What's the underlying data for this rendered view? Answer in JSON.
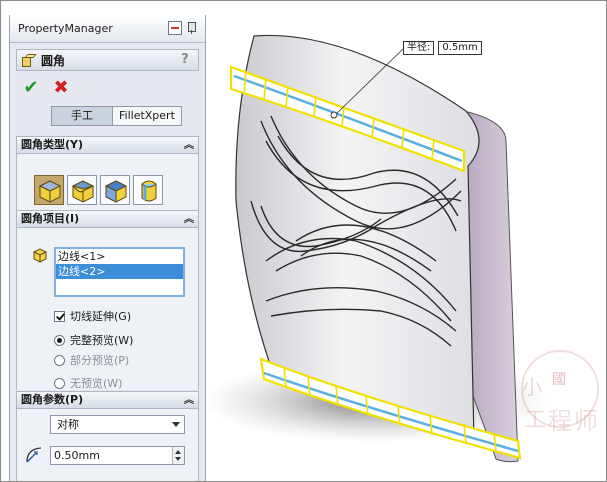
{
  "property_manager": {
    "title": "PropertyManager",
    "feature_title": "圆角",
    "help_label": "?",
    "ok_symbol": "✔",
    "cancel_symbol": "✖",
    "mode_tabs": [
      {
        "label": "手工",
        "active": true
      },
      {
        "label": "FilletXpert",
        "active": false
      }
    ]
  },
  "sections": {
    "fillet_type": {
      "title": "圆角类型(Y)"
    },
    "fillet_items": {
      "title": "圆角项目(I)",
      "items": [
        "边线<1>",
        "边线<2>"
      ],
      "selected_index": 1,
      "tangent_propagation": {
        "label": "切线延伸(G)",
        "checked": true
      },
      "preview_options": [
        {
          "label": "完整预览(W)",
          "checked": true
        },
        {
          "label": "部分预览(P)",
          "checked": false
        },
        {
          "label": "无预览(W)",
          "checked": false
        }
      ]
    },
    "fillet_params": {
      "title": "圆角参数(P)",
      "mode_value": "对称",
      "radius_value": "0.50mm"
    }
  },
  "viewport": {
    "dimension_label": "半径:",
    "dimension_value": "0.5mm",
    "watermark_chars": [
      "小",
      "國",
      "工",
      "程",
      "师"
    ]
  },
  "colors": {
    "panel_bg": "#e6eaf0",
    "selection_blue": "#3c8ed8",
    "edge_highlight": "#f2e000",
    "ok_green": "#1f9b2b",
    "cancel_red": "#d22020"
  }
}
